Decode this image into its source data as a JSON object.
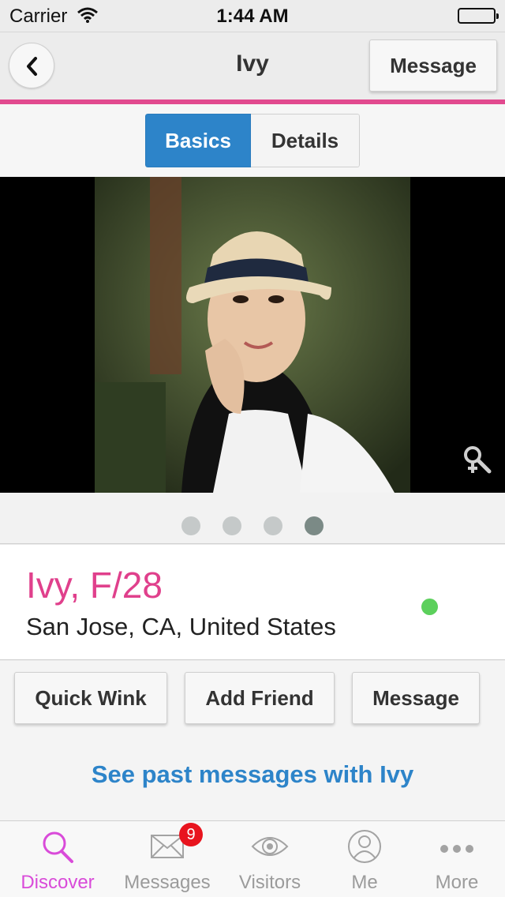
{
  "status_bar": {
    "carrier": "Carrier",
    "time": "1:44 AM"
  },
  "nav": {
    "title": "Ivy",
    "message_label": "Message",
    "back_icon": "chevron-left-icon"
  },
  "colors": {
    "accent_pink": "#e24a8f",
    "tab_blue": "#2d84c9",
    "online_green": "#5cd05c",
    "badge_red": "#e8141e",
    "tab_active": "#d94bd9"
  },
  "tabs": [
    {
      "label": "Basics",
      "selected": true
    },
    {
      "label": "Details",
      "selected": false
    }
  ],
  "photo": {
    "alt": "Ivy",
    "zoom_icon": "zoom-female-icon"
  },
  "pager": {
    "count": 4,
    "active_index": 3
  },
  "profile": {
    "name": "Ivy, F/28",
    "location": "San Jose, CA, United States",
    "online": true
  },
  "actions": {
    "quick_wink": "Quick Wink",
    "add_friend": "Add Friend",
    "message": "Message"
  },
  "past_messages_link": "See past messages with Ivy",
  "tab_bar": {
    "items": [
      {
        "label": "Discover",
        "icon": "search-icon",
        "active": true
      },
      {
        "label": "Messages",
        "icon": "envelope-icon",
        "badge": "9"
      },
      {
        "label": "Visitors",
        "icon": "eye-icon"
      },
      {
        "label": "Me",
        "icon": "person-icon"
      },
      {
        "label": "More",
        "icon": "more-dots-icon"
      }
    ]
  }
}
